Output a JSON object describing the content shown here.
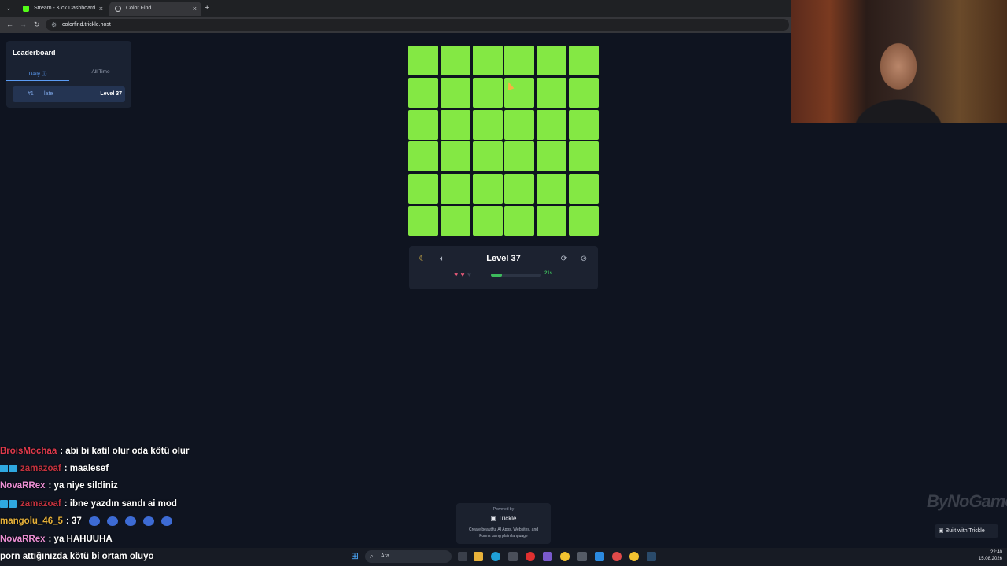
{
  "browser": {
    "tabs": [
      {
        "label": "Stream - Kick Dashboard",
        "close": "×"
      },
      {
        "label": "Color Find",
        "close": "×"
      }
    ],
    "new_tab": "+",
    "url": "colorfind.trickle.host"
  },
  "leaderboard": {
    "title": "Leaderboard",
    "tabs": {
      "daily": "Daily ⓘ",
      "all_time": "All Time"
    },
    "entries": [
      {
        "rank": "#1",
        "name": "late",
        "level": "Level 37"
      }
    ]
  },
  "game": {
    "grid_size": 6,
    "cell_color": "#84e844",
    "level_label": "Level 37",
    "lives": {
      "total": 3,
      "remaining": 2
    },
    "timer_text": "21s",
    "timer_progress": 0.22,
    "icons": {
      "theme": "moon-icon",
      "sound": "mute-icon",
      "restart": "refresh-icon",
      "hide": "eye-off-icon"
    }
  },
  "chat": {
    "messages": [
      {
        "user": "BroisMochaa",
        "color": "#e03a4c",
        "text": ": abi bi katil olur oda kötü olur",
        "badges": 0,
        "emotes": 0
      },
      {
        "user": "zamazoaf",
        "color": "#c4323e",
        "text": ": maalesef",
        "badges": 2,
        "emotes": 0
      },
      {
        "user": "NovaRRex",
        "color": "#ec8fd4",
        "text": ": ya niye sildiniz",
        "badges": 0,
        "emotes": 0
      },
      {
        "user": "zamazoaf",
        "color": "#c4323e",
        "text": ": ibne yazdın sandı ai mod",
        "badges": 2,
        "emotes": 0
      },
      {
        "user": "mangolu_46_5",
        "color": "#e8b23a",
        "text": ": 37",
        "badges": 0,
        "emotes": 5
      },
      {
        "user": "NovaRRex",
        "color": "#ec8fd4",
        "text": ": ya HAHUUHA",
        "badges": 0,
        "emotes": 0
      }
    ],
    "partial_line": "porn attığınızda kötü bi ortam oluyo"
  },
  "powered_by": {
    "label": "Powered by",
    "brand": "Trickle",
    "description": "Create beautiful AI Apps, Websites, and Forms using plain language"
  },
  "watermark": "ByNoGame",
  "built_with": "Built with Trickle",
  "taskbar": {
    "search_placeholder": "Ara",
    "time": "22:40",
    "date": "15.08.2026"
  }
}
